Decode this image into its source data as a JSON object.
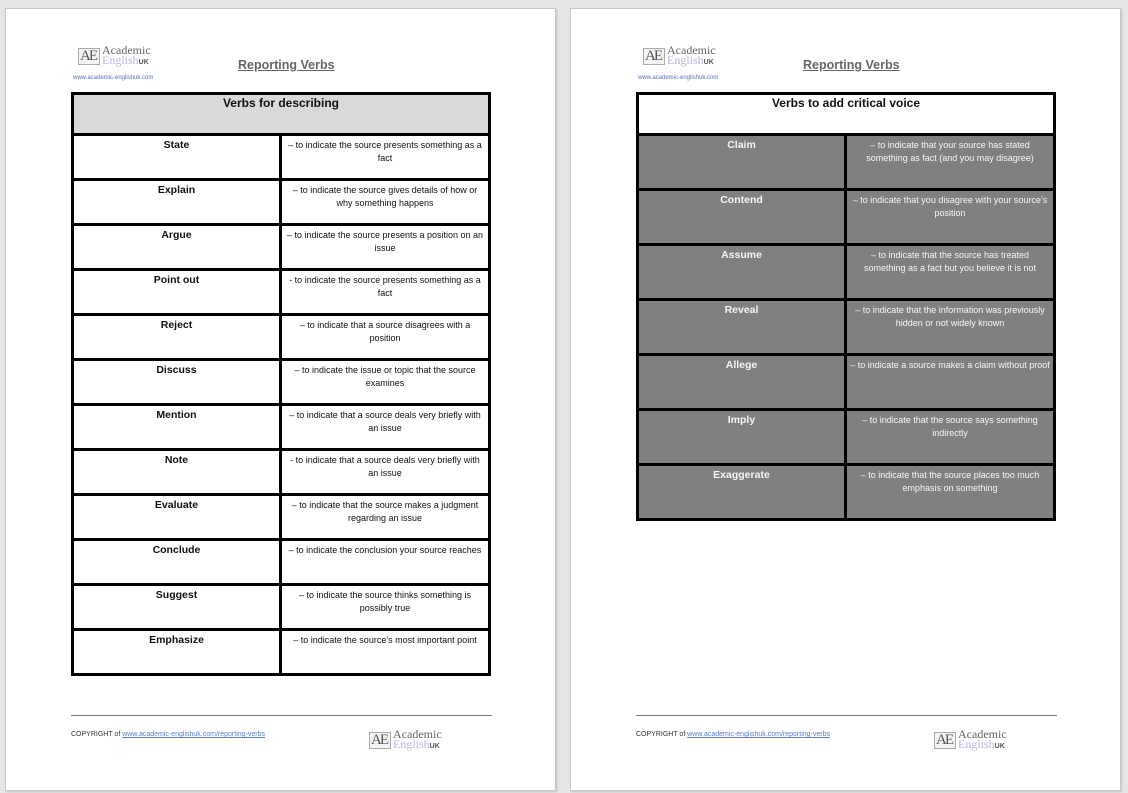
{
  "pages": [
    {
      "logo": {
        "mark": "AE",
        "line1": "Academic",
        "line2": "English",
        "suffix": "UK"
      },
      "site_url": "www.academic-englishuk.com",
      "title": "Reporting Verbs",
      "table": {
        "heading": "Verbs for describing",
        "rows": [
          {
            "verb": "State",
            "description": "– to indicate the source presents something as a fact"
          },
          {
            "verb": "Explain",
            "description": "– to indicate the source gives details of how or why something happens"
          },
          {
            "verb": "Argue",
            "description": "– to indicate the source presents a position on an issue"
          },
          {
            "verb": "Point out",
            "description": "- to indicate the source presents something as a fact"
          },
          {
            "verb": "Reject",
            "description": "– to indicate that a source disagrees with a position"
          },
          {
            "verb": "Discuss",
            "description": "– to indicate the issue or topic that the source examines"
          },
          {
            "verb": "Mention",
            "description": "– to indicate that a source deals very briefly with an issue"
          },
          {
            "verb": "Note",
            "description": "- to indicate that a source deals very briefly with an issue"
          },
          {
            "verb": "Evaluate",
            "description": "– to indicate that the source makes a judgment regarding an issue"
          },
          {
            "verb": "Conclude",
            "description": "– to indicate the conclusion your source reaches"
          },
          {
            "verb": "Suggest",
            "description": "– to indicate the source thinks something is possibly true"
          },
          {
            "verb": "Emphasize",
            "description": "– to indicate the source’s most important point"
          }
        ]
      },
      "footer": {
        "copyright_prefix": "COPYRIGHT of ",
        "copyright_link": "www.academic-englishuk.com/reporting-verbs"
      }
    },
    {
      "logo": {
        "mark": "AE",
        "line1": "Academic",
        "line2": "English",
        "suffix": "UK"
      },
      "site_url": "www.academic-englishuk.com",
      "title": "Reporting Verbs",
      "table": {
        "heading": "Verbs to add critical voice",
        "rows": [
          {
            "verb": "Claim",
            "description": "– to indicate that your source has stated something as fact (and you may disagree)"
          },
          {
            "verb": "Contend",
            "description": "– to indicate that you disagree with your source’s position"
          },
          {
            "verb": "Assume",
            "description": "– to indicate that the source has treated something as a fact but you believe it is not"
          },
          {
            "verb": "Reveal",
            "description": "– to indicate that the information was previously hidden or not widely known"
          },
          {
            "verb": "Allege",
            "description": "– to indicate a source makes a claim without proof"
          },
          {
            "verb": "Imply",
            "description": "– to indicate that the source says something indirectly"
          },
          {
            "verb": "Exaggerate",
            "description": "– to indicate that the source places too much emphasis on something"
          }
        ]
      },
      "footer": {
        "copyright_prefix": "COPYRIGHT of ",
        "copyright_link": "www.academic-englishuk.com/reporting-verbs"
      }
    }
  ],
  "colors": {
    "describe_header_bg": "#d9d9d9",
    "critical_cell_bg": "#808080",
    "link": "#5b7fc7"
  }
}
